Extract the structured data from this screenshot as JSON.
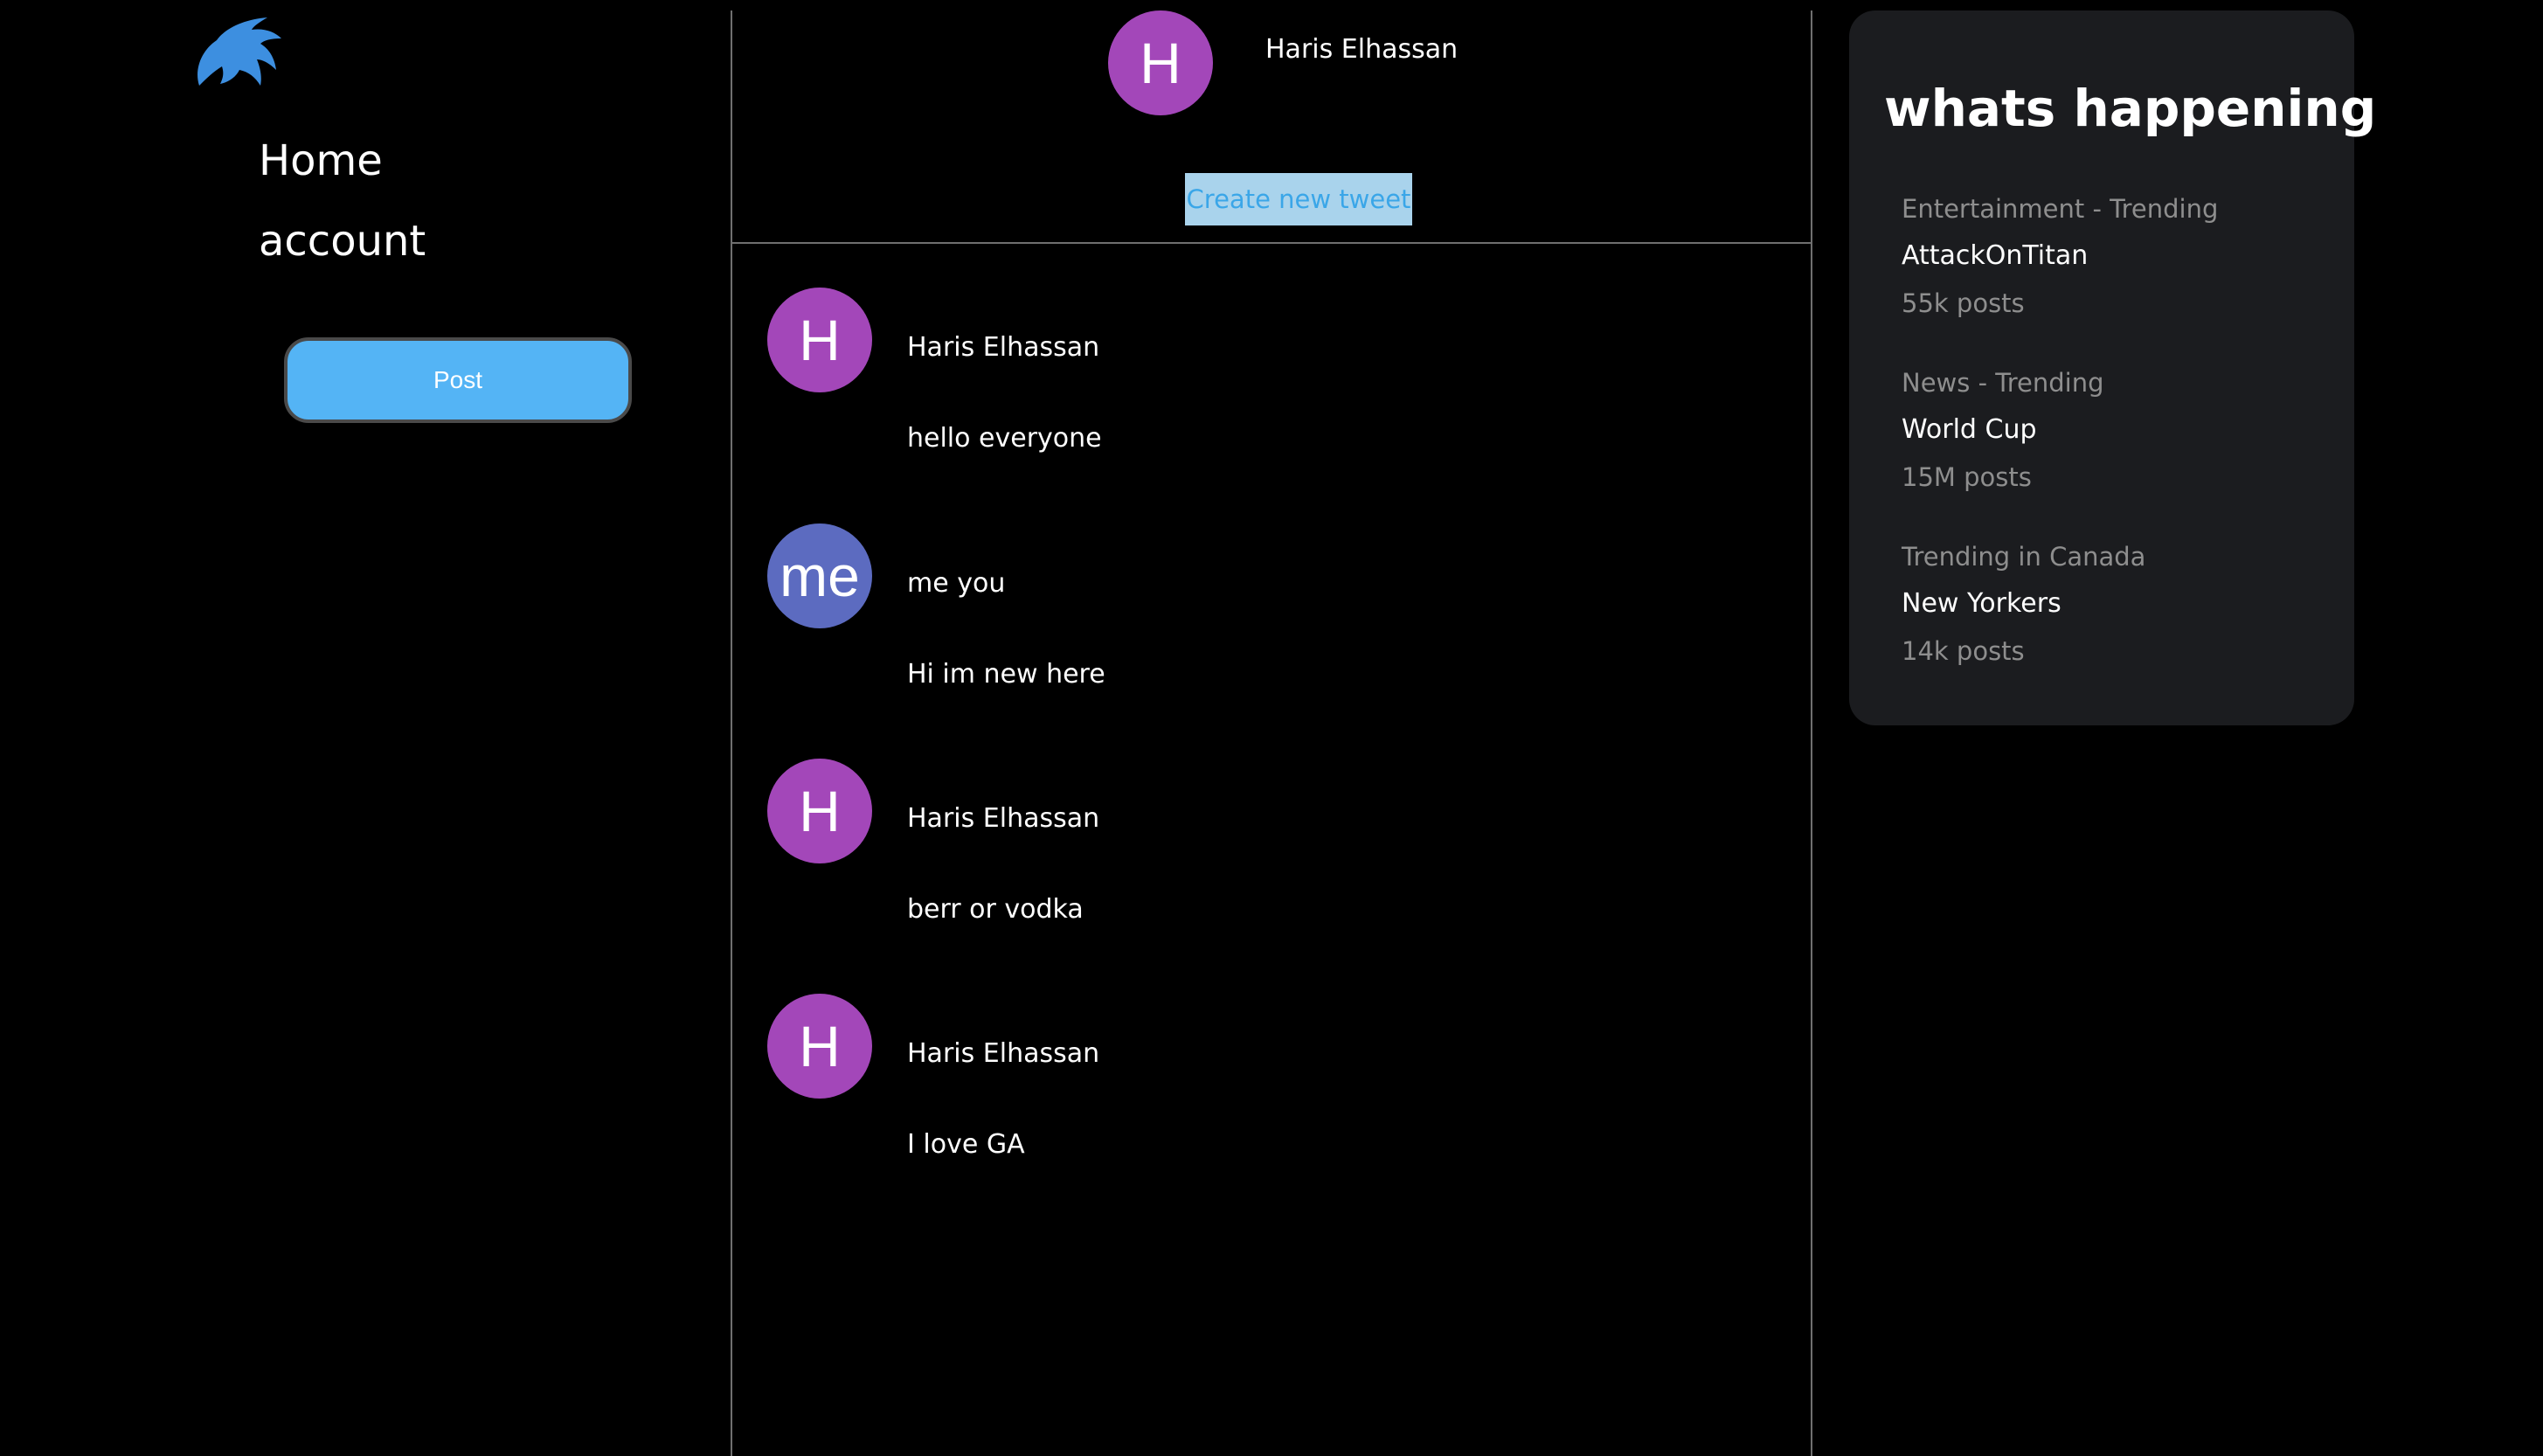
{
  "sidebar": {
    "logo_icon": "bird-logo-icon",
    "nav": {
      "home_label": "Home",
      "account_label": "account"
    },
    "post_button_label": "Post"
  },
  "header": {
    "avatar_initial": "H",
    "user_name": "Haris Elhassan",
    "create_tweet_label": "Create new tweet"
  },
  "tweets": [
    {
      "avatar_initial": "H",
      "avatar_color": "#a347b9",
      "author": "Haris Elhassan",
      "text": "hello everyone"
    },
    {
      "avatar_initial": "me",
      "avatar_color": "#5c6bc0",
      "author": "me you",
      "text": "Hi im new here"
    },
    {
      "avatar_initial": "H",
      "avatar_color": "#a347b9",
      "author": "Haris Elhassan",
      "text": "berr or vodka"
    },
    {
      "avatar_initial": "H",
      "avatar_color": "#a347b9",
      "author": "Haris Elhassan",
      "text": "I love GA"
    }
  ],
  "trends": {
    "title": "whats happening",
    "items": [
      {
        "category": "Entertainment - Trending",
        "topic": "AttackOnTitan",
        "posts": "55k posts"
      },
      {
        "category": "News - Trending",
        "topic": "World Cup",
        "posts": "15M posts"
      },
      {
        "category": "Trending in Canada",
        "topic": "New Yorkers",
        "posts": "14k posts"
      }
    ]
  },
  "colors": {
    "background": "#000000",
    "accent_blue": "#54b4f5",
    "create_button_bg": "#a9d3ec",
    "create_button_text": "#3aa6e8",
    "avatar_purple": "#a347b9",
    "avatar_indigo": "#5c6bc0",
    "panel_bg": "#1b1c1f",
    "muted_text": "#8e8e8e",
    "divider": "#6f6f6f"
  }
}
